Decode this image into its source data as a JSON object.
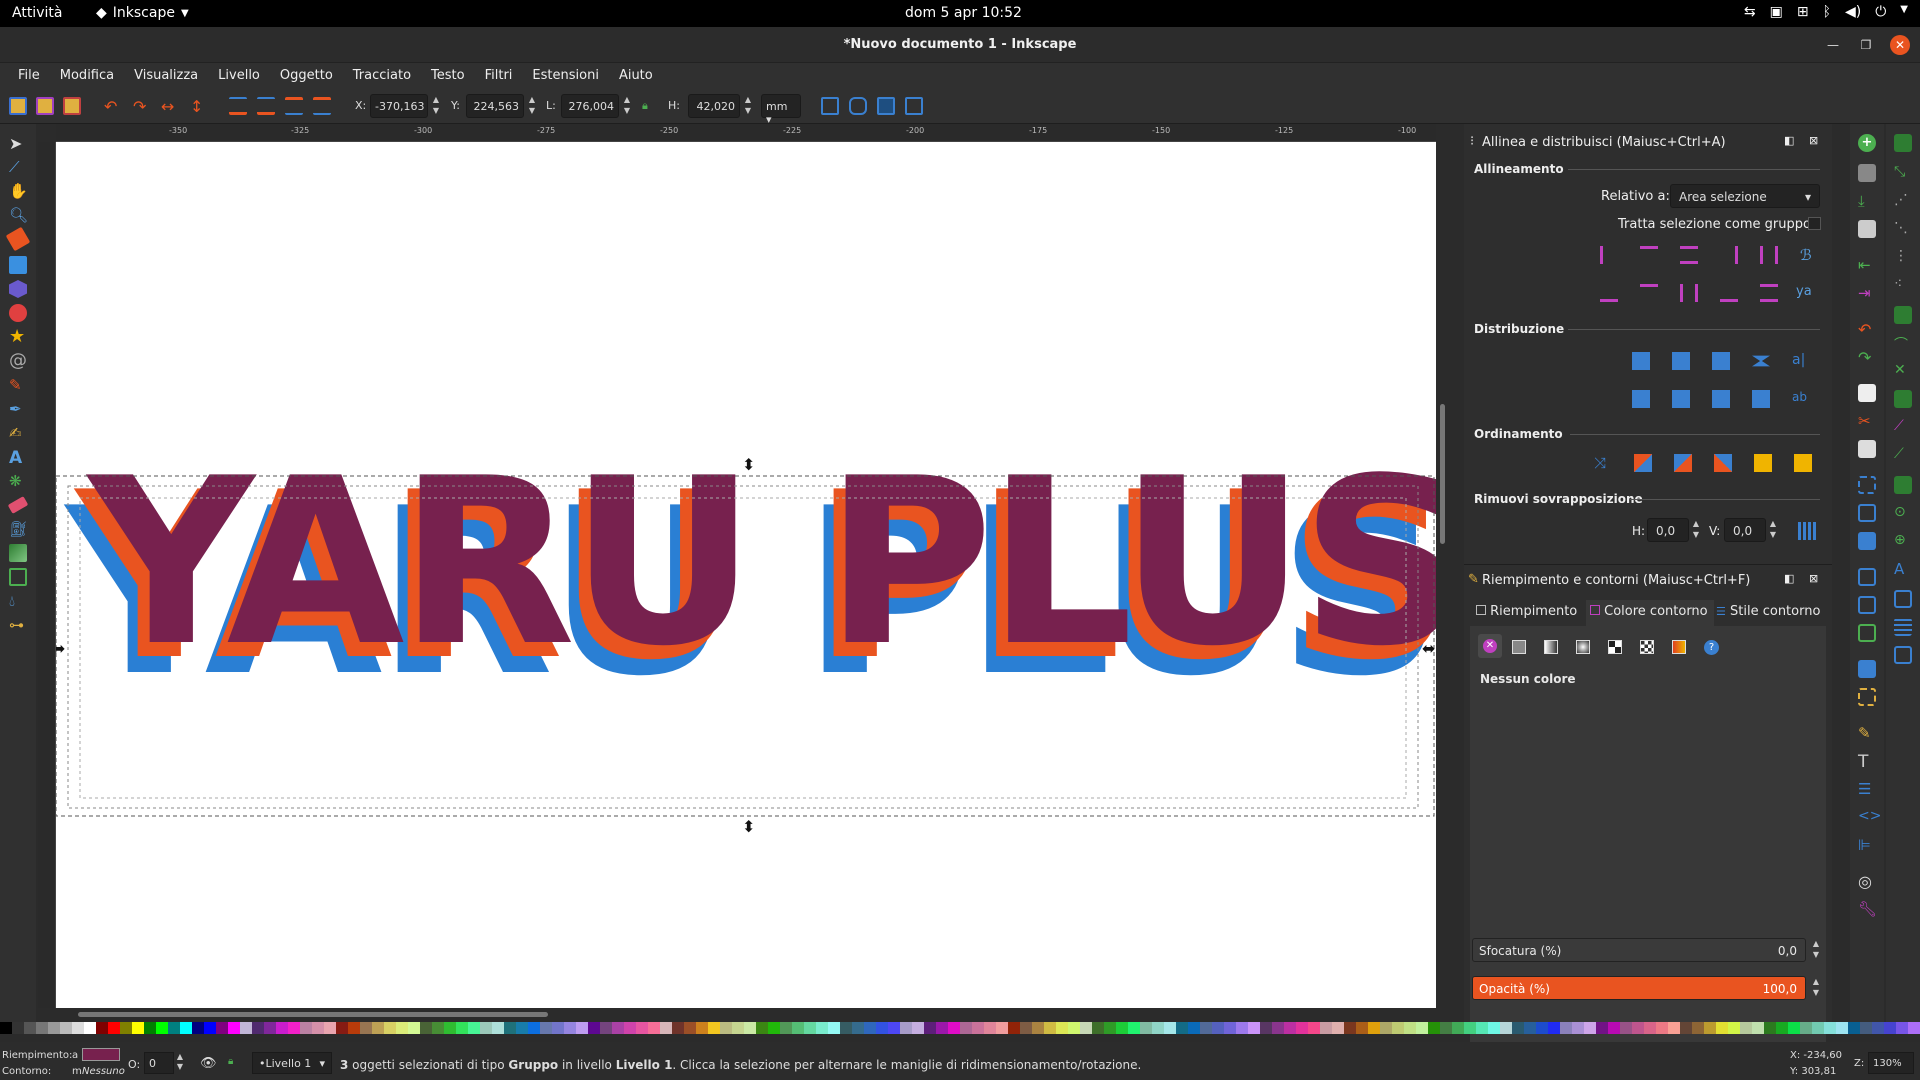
{
  "topbar": {
    "activities": "Attività",
    "app_name": "Inkscape",
    "clock": "dom 5 apr  10:52"
  },
  "window": {
    "title": "*Nuovo documento 1 - Inkscape"
  },
  "menu": [
    "File",
    "Modifica",
    "Visualizza",
    "Livello",
    "Oggetto",
    "Tracciato",
    "Testo",
    "Filtri",
    "Estensioni",
    "Aiuto"
  ],
  "toolbar": {
    "x_label": "X:",
    "x_value": "-370,163",
    "y_label": "Y:",
    "y_value": "224,563",
    "w_label": "L:",
    "w_value": "276,004",
    "h_label": "H:",
    "h_value": "42,020",
    "unit": "mm"
  },
  "ruler": {
    "h_ticks": [
      "-350",
      "-325",
      "-300",
      "-275",
      "-250",
      "-225",
      "-200",
      "-175",
      "-150",
      "-125",
      "-100"
    ]
  },
  "canvas": {
    "artwork_text": "YARU PLUS",
    "colors": {
      "back": "#2a7fd4",
      "middle": "#e95420",
      "front": "#77214e"
    }
  },
  "align_panel": {
    "title": "Allinea e distribuisci (Maiusc+Ctrl+A)",
    "section_align": "Allineamento",
    "relative_label": "Relativo a:",
    "relative_value": "Area selezione",
    "group_label": "Tratta selezione come gruppo:",
    "section_distribute": "Distribuzione",
    "section_order": "Ordinamento",
    "section_overlap": "Rimuovi sovrapposizione",
    "h_label": "H:",
    "h_value": "0,0",
    "v_label": "V:",
    "v_value": "0,0"
  },
  "fill_panel": {
    "title": "Riempimento e contorni (Maiusc+Ctrl+F)",
    "tabs": [
      "Riempimento",
      "Colore contorno",
      "Stile contorno"
    ],
    "no_color": "Nessun colore",
    "blur_label": "Sfocatura (%)",
    "blur_value": "0,0",
    "opacity_label": "Opacità (%)",
    "opacity_value": "100,0",
    "opacity_percent": 100
  },
  "status": {
    "fill_label": "Riempimento:",
    "fill_flag": "a",
    "stroke_label": "Contorno:",
    "stroke_flag": "m",
    "stroke_value": "Nessuno",
    "opacity_label": "O:",
    "opacity_value": "0",
    "layer": "•Livello 1",
    "message_count": "3",
    "message_pre": " oggetti selezionati di tipo ",
    "message_type": "Gruppo",
    "message_mid": " in livello ",
    "message_layer": "Livello 1",
    "message_post": ". Clicca la selezione per alternare le maniglie di ridimensionamento/rotazione.",
    "cursor_x": "X: -234,60",
    "cursor_y": "Y:   303,81",
    "zoom_label": "Z:",
    "zoom_value": "130%"
  }
}
